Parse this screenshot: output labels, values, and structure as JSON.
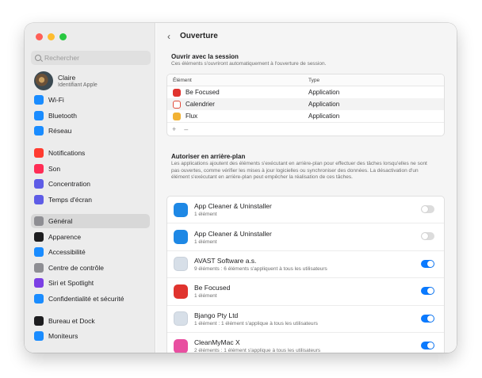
{
  "search": {
    "placeholder": "Rechercher"
  },
  "user": {
    "name": "Claire",
    "subtitle": "Identifiant Apple"
  },
  "sidebar": {
    "items": [
      {
        "label": "Wi-Fi",
        "icon": "wifi-icon",
        "color": "#1a8cff"
      },
      {
        "label": "Bluetooth",
        "icon": "bluetooth-icon",
        "color": "#1a8cff"
      },
      {
        "label": "Réseau",
        "icon": "network-icon",
        "color": "#1a8cff"
      },
      {
        "label": "Notifications",
        "icon": "bell-icon",
        "color": "#ff3b30"
      },
      {
        "label": "Son",
        "icon": "speaker-icon",
        "color": "#ff2d55"
      },
      {
        "label": "Concentration",
        "icon": "moon-icon",
        "color": "#5e5ce6"
      },
      {
        "label": "Temps d'écran",
        "icon": "hourglass-icon",
        "color": "#5e5ce6"
      },
      {
        "label": "Général",
        "icon": "gear-icon",
        "color": "#8e8e93",
        "selected": true
      },
      {
        "label": "Apparence",
        "icon": "appearance-icon",
        "color": "#1d1d1f"
      },
      {
        "label": "Accessibilité",
        "icon": "accessibility-icon",
        "color": "#1a8cff"
      },
      {
        "label": "Centre de contrôle",
        "icon": "control-center-icon",
        "color": "#8e8e93"
      },
      {
        "label": "Siri et Spotlight",
        "icon": "siri-icon",
        "color": "#7b3fe4"
      },
      {
        "label": "Confidentialité et sécurité",
        "icon": "hand-icon",
        "color": "#1a8cff"
      },
      {
        "label": "Bureau et Dock",
        "icon": "dock-icon",
        "color": "#1d1d1f"
      },
      {
        "label": "Moniteurs",
        "icon": "sun-icon",
        "color": "#1a8cff"
      }
    ]
  },
  "header": {
    "title": "Ouverture"
  },
  "login": {
    "title": "Ouvrir avec la session",
    "subtitle": "Ces éléments s'ouvriront automatiquement à l'ouverture de session.",
    "col_element": "Élément",
    "col_type": "Type",
    "rows": [
      {
        "name": "Be Focused",
        "type": "Application",
        "icon": "be-focused-icon",
        "color": "#e0332e"
      },
      {
        "name": "Calendrier",
        "type": "Application",
        "icon": "calendar-icon",
        "color": "#ffffff"
      },
      {
        "name": "Flux",
        "type": "Application",
        "icon": "flux-icon",
        "color": "#f2b233"
      }
    ],
    "add": "+",
    "remove": "–"
  },
  "background": {
    "title": "Autoriser en arrière-plan",
    "subtitle": "Les applications ajoutent des éléments s'exécutant en arrière-plan pour effectuer des tâches lorsqu'elles ne sont pas ouvertes, comme vérifier les mises à jour logicielles ou synchroniser des données. La désactivation d'un élément s'exécutant en arrière-plan peut empêcher la réalisation de ces tâches.",
    "items": [
      {
        "name": "App Cleaner & Uninstaller",
        "detail": "1 élément",
        "enabled": false,
        "icon": "app-cleaner-icon",
        "color": "#1e88e5"
      },
      {
        "name": "App Cleaner & Uninstaller",
        "detail": "1 élément",
        "enabled": false,
        "icon": "app-cleaner-icon",
        "color": "#1e88e5"
      },
      {
        "name": "AVAST Software a.s.",
        "detail": "9 éléments : 6 éléments s'appliquent à tous les utilisateurs",
        "enabled": true,
        "icon": "generic-app-icon",
        "color": "#d7dfe8"
      },
      {
        "name": "Be Focused",
        "detail": "1 élément",
        "enabled": true,
        "icon": "be-focused-icon",
        "color": "#e0332e"
      },
      {
        "name": "Bjango Pty Ltd",
        "detail": "1 élément : 1 élément s'applique à tous les utilisateurs",
        "enabled": true,
        "icon": "generic-app-icon",
        "color": "#d7dfe8"
      },
      {
        "name": "CleanMyMac X",
        "detail": "2 éléments : 1 élément s'applique à tous les utilisateurs",
        "enabled": true,
        "icon": "cleanmymac-icon",
        "color": "#e84fa0"
      }
    ]
  }
}
